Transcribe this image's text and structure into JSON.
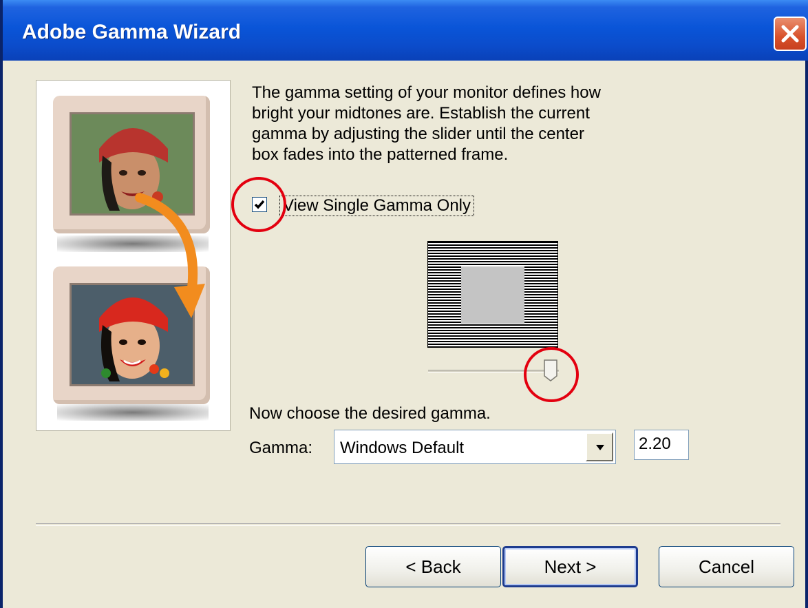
{
  "window": {
    "title": "Adobe Gamma Wizard"
  },
  "description": "The gamma setting of your monitor defines how\nbright your midtones are. Establish the current\ngamma by adjusting the slider until the center\nbox fades into the patterned frame.",
  "checkbox": {
    "label": "View Single Gamma Only",
    "checked": true
  },
  "choose_text": "Now choose the desired gamma.",
  "gamma": {
    "label": "Gamma:",
    "selected": "Windows Default",
    "value": "2.20"
  },
  "slider": {
    "value_fraction": 0.96
  },
  "buttons": {
    "back": "< Back",
    "next": "Next >",
    "cancel": "Cancel"
  },
  "colors": {
    "title_bar": "#0A55D8",
    "dialog_bg": "#ECE9D8",
    "highlight_circle": "#E3000F",
    "arrow": "#F28C1E"
  }
}
